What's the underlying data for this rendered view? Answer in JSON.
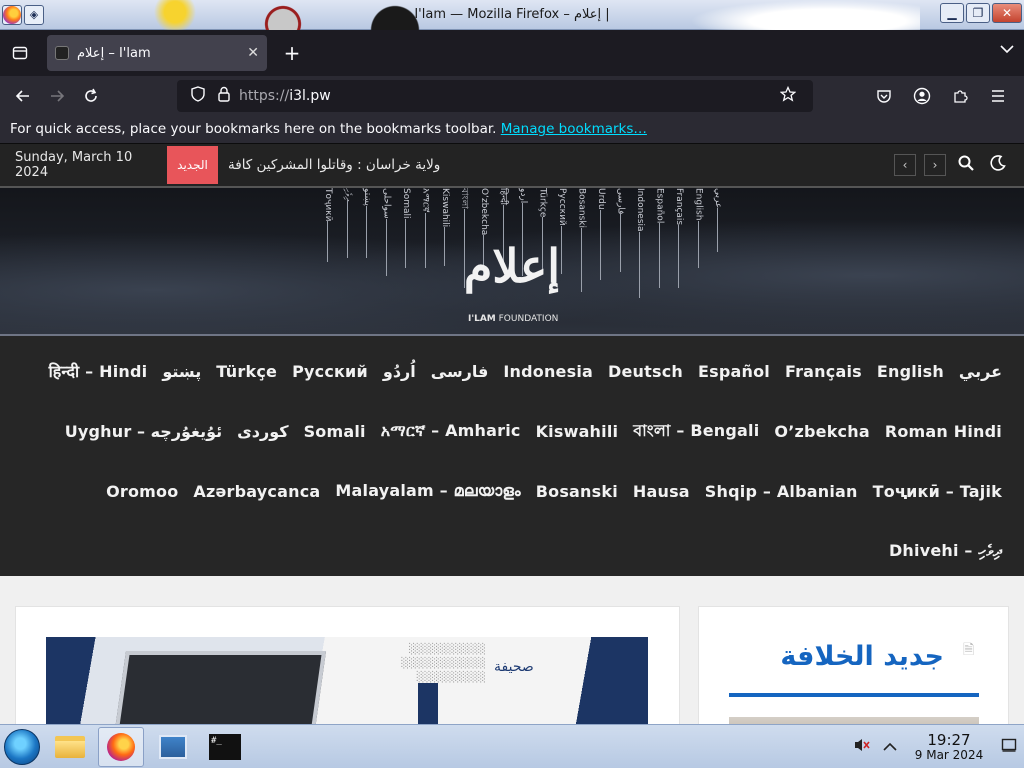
{
  "os": {
    "window_title": "I'lam — Mozilla Firefox – إعلام |",
    "buttons": {
      "minimize": "▁",
      "maximize": "❐",
      "close": "✕"
    }
  },
  "browser": {
    "tab_title": "إعلام – I'lam",
    "url_proto": "https://",
    "url_host": "i3l.pw",
    "bookmarks_prompt": "For quick access, place your bookmarks here on the bookmarks toolbar.",
    "bookmarks_link": "Manage bookmarks…",
    "icons": {
      "tab_list": "tab-list-icon",
      "close_tab": "close-icon",
      "new_tab": "plus-icon",
      "back": "back-arrow-icon",
      "forward": "forward-arrow-icon",
      "reload": "reload-icon",
      "shield": "shield-icon",
      "lock": "lock-icon",
      "star": "star-icon",
      "pocket": "pocket-icon",
      "account": "account-icon",
      "extensions": "puzzle-icon",
      "menu": "hamburger-menu-icon"
    }
  },
  "site": {
    "date": "Sunday, March 10 2024",
    "new_badge": "الجديد",
    "ticker": "ولاية خراسان : وقاتلوا المشركين كافة",
    "banner_languages": [
      "Тоҷикӣ",
      "ދިވެހި",
      "پښتو",
      "سواحلی",
      "Somali",
      "አማርኛ",
      "Kiswahili",
      "বাংলা",
      "Oʻzbekcha",
      "हिन्दी",
      "اردو",
      "Türkçe",
      "Русский",
      "Bosanski",
      "Urdu",
      "فارسی",
      "Indonesia",
      "Español",
      "Français",
      "English",
      "عربي"
    ],
    "banner_logo": "إعلام",
    "banner_sub_bold": "I'LAM",
    "banner_sub": " FOUNDATION",
    "language_rows": [
      [
        "عربي",
        "English",
        "Français",
        "Español",
        "Deutsch",
        "Indonesia",
        "فارسی",
        "اُردُو",
        "Русский",
        "Türkçe",
        "پښتو",
        "हिन्दी – Hindi"
      ],
      [
        "Roman Hindi",
        "O’zbekcha",
        "বাংলা – Bengali",
        "Kiswahili",
        "አማርኛ – Amharic",
        "Somali",
        "کوردی",
        "ئۇيغۇرچە – Uyghur"
      ],
      [
        "Тоҷикӣ – Tajik",
        "Shqip – Albanian",
        "Hausa",
        "Bosanski",
        "Malayalam – മലയാളം",
        "Azərbaycanca",
        "Oromoo"
      ],
      [
        "Dhivehi – ދިވެހި"
      ]
    ],
    "magazine_title": "صحيفة",
    "sidebar_heading": "جديد الخلافة",
    "accent_color": "#1565c0",
    "badge_color": "#e8555a"
  },
  "taskbar": {
    "time": "19:27",
    "date": "9 Mar 2024",
    "terminal_label": "#_"
  }
}
